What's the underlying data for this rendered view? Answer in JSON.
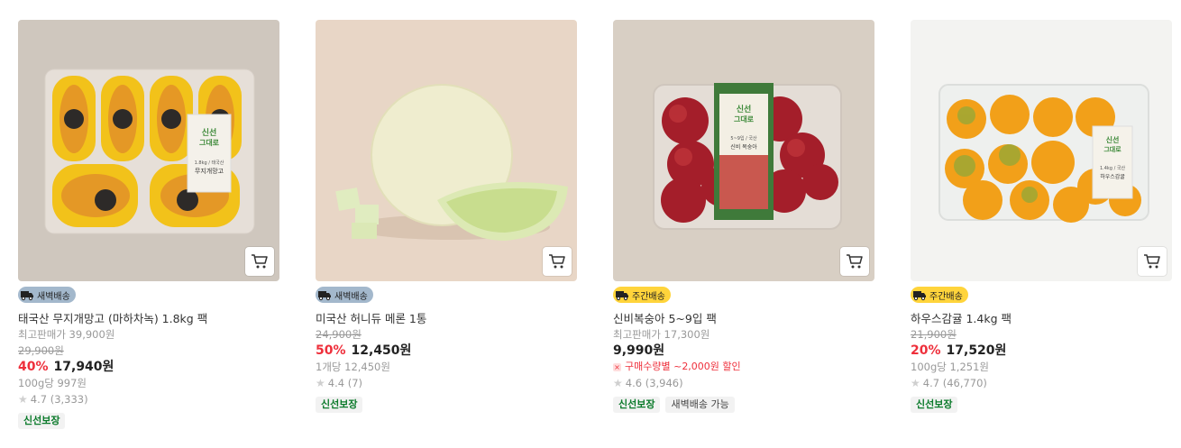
{
  "products": [
    {
      "badge": "새벽배송",
      "name": "태국산 무지개망고 (마하차녹) 1.8kg 팩",
      "lowest_price_text": "최고판매가 39,900원",
      "original_price": "29,900원",
      "discount": "40%",
      "price": "17,940원",
      "unit_price": "100g당 997원",
      "rating": "4.7 (3,333)",
      "tags": [
        "신선보장"
      ],
      "thumb_text_1": "신선",
      "thumb_text_2": "그대로",
      "thumb_text_3": "1.8kg / 태국산",
      "thumb_text_4": "무지개망고"
    },
    {
      "badge": "새벽배송",
      "name": "미국산 허니듀 메론 1통",
      "original_price": "24,900원",
      "discount": "50%",
      "price": "12,450원",
      "unit_price": "1개당 12,450원",
      "rating": "4.4 (7)",
      "tags": [
        "신선보장"
      ]
    },
    {
      "badge": "주간배송",
      "name": "신비복숭아 5~9입 팩",
      "lowest_price_text": "최고판매가 17,300원",
      "price": "9,990원",
      "coupon": "구매수량별 ~2,000원 할인",
      "rating": "4.6 (3,946)",
      "tags": [
        "신선보장",
        "새벽배송 가능"
      ],
      "thumb_text_1": "신선",
      "thumb_text_2": "그대로",
      "thumb_text_3": "5~9입 / 국산",
      "thumb_text_4": "신비 복숭아"
    },
    {
      "badge": "주간배송",
      "name": "하우스감귤 1.4kg 팩",
      "original_price": "21,900원",
      "discount": "20%",
      "price": "17,520원",
      "unit_price": "100g당 1,251원",
      "rating": "4.7 (46,770)",
      "tags": [
        "신선보장"
      ],
      "thumb_text_1": "신선",
      "thumb_text_2": "그대로",
      "thumb_text_3": "1.4kg / 국산",
      "thumb_text_4": "하우스감귤"
    }
  ],
  "colors": {
    "discount": "#ee2f3b",
    "dawn_badge": "#a3b8cc",
    "weekly_badge": "#ffd43b",
    "fresh_tag": "#0a7a2a"
  },
  "icons": {
    "cart": "cart-icon",
    "truck": "truck-icon",
    "star": "star-icon"
  }
}
